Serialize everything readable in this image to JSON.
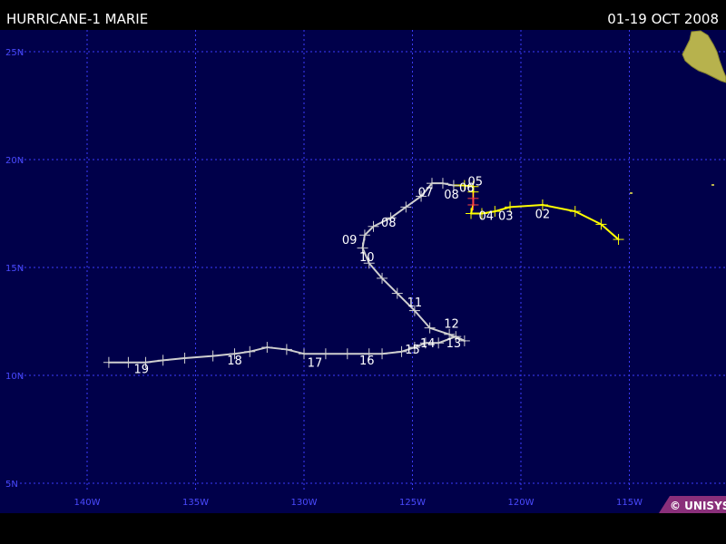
{
  "header": {
    "title": "HURRICANE-1 MARIE",
    "date_range": "01-19 OCT 2008"
  },
  "map": {
    "lat_labels": [
      {
        "lat": 25,
        "label": "25N"
      },
      {
        "lat": 20,
        "label": "20N"
      },
      {
        "lat": 15,
        "label": "15N"
      },
      {
        "lat": 10,
        "label": "10N"
      },
      {
        "lat": 5,
        "label": "5N"
      }
    ],
    "lon_labels": [
      {
        "lon": -140,
        "label": "140W"
      },
      {
        "lon": -135,
        "label": "135W"
      },
      {
        "lon": -130,
        "label": "130W"
      },
      {
        "lon": -125,
        "label": "125W"
      },
      {
        "lon": -120,
        "label": "120W"
      },
      {
        "lon": -115,
        "label": "115W"
      }
    ],
    "colors": {
      "ocean": "#00004a",
      "grid": "#3b3bff",
      "axis_label": "#4a4aff",
      "land": "#b7b24d",
      "track_storm": "#ffff00",
      "track_depression": "#cfcfcf",
      "track_hurricane": "#ff4444",
      "day_label": "#ffffff"
    },
    "land_icon": "land-mass-baja-california",
    "credit": "© UNISYS"
  },
  "chart_data": {
    "type": "map-track",
    "track": [
      {
        "lon": -115.5,
        "lat": 16.3,
        "stage": "storm"
      },
      {
        "lon": -116.3,
        "lat": 17.0,
        "stage": "storm"
      },
      {
        "lon": -117.5,
        "lat": 17.6,
        "stage": "storm"
      },
      {
        "lon": -119.0,
        "lat": 17.9,
        "stage": "storm"
      },
      {
        "lon": -120.5,
        "lat": 17.8,
        "stage": "storm"
      },
      {
        "lon": -121.2,
        "lat": 17.6,
        "stage": "storm"
      },
      {
        "lon": -121.8,
        "lat": 17.5,
        "stage": "storm"
      },
      {
        "lon": -122.3,
        "lat": 17.5,
        "stage": "storm"
      },
      {
        "lon": -122.2,
        "lat": 17.9,
        "stage": "hurricane"
      },
      {
        "lon": -122.2,
        "lat": 18.2,
        "stage": "hurricane"
      },
      {
        "lon": -122.2,
        "lat": 18.5,
        "stage": "storm"
      },
      {
        "lon": -122.2,
        "lat": 18.75,
        "stage": "storm"
      },
      {
        "lon": -122.6,
        "lat": 18.8,
        "stage": "storm"
      },
      {
        "lon": -123.1,
        "lat": 18.8,
        "stage": "depression"
      },
      {
        "lon": -123.6,
        "lat": 18.9,
        "stage": "depression"
      },
      {
        "lon": -124.1,
        "lat": 18.9,
        "stage": "depression"
      },
      {
        "lon": -124.6,
        "lat": 18.3,
        "stage": "depression"
      },
      {
        "lon": -125.3,
        "lat": 17.8,
        "stage": "depression"
      },
      {
        "lon": -126.0,
        "lat": 17.3,
        "stage": "depression"
      },
      {
        "lon": -126.8,
        "lat": 16.9,
        "stage": "depression"
      },
      {
        "lon": -127.2,
        "lat": 16.5,
        "stage": "depression"
      },
      {
        "lon": -127.3,
        "lat": 15.9,
        "stage": "depression"
      },
      {
        "lon": -127.0,
        "lat": 15.2,
        "stage": "depression"
      },
      {
        "lon": -126.4,
        "lat": 14.5,
        "stage": "depression"
      },
      {
        "lon": -125.7,
        "lat": 13.8,
        "stage": "depression"
      },
      {
        "lon": -124.9,
        "lat": 13.0,
        "stage": "depression"
      },
      {
        "lon": -124.2,
        "lat": 12.2,
        "stage": "depression"
      },
      {
        "lon": -123.3,
        "lat": 11.9,
        "stage": "depression"
      },
      {
        "lon": -122.6,
        "lat": 11.6,
        "stage": "depression"
      },
      {
        "lon": -123.0,
        "lat": 11.8,
        "stage": "depression"
      },
      {
        "lon": -123.8,
        "lat": 11.5,
        "stage": "depression"
      },
      {
        "lon": -124.4,
        "lat": 11.5,
        "stage": "depression"
      },
      {
        "lon": -124.9,
        "lat": 11.3,
        "stage": "depression"
      },
      {
        "lon": -125.5,
        "lat": 11.1,
        "stage": "depression"
      },
      {
        "lon": -126.4,
        "lat": 11.0,
        "stage": "depression"
      },
      {
        "lon": -127.0,
        "lat": 11.0,
        "stage": "depression"
      },
      {
        "lon": -128.0,
        "lat": 11.0,
        "stage": "depression"
      },
      {
        "lon": -129.0,
        "lat": 11.0,
        "stage": "depression"
      },
      {
        "lon": -130.0,
        "lat": 11.0,
        "stage": "depression"
      },
      {
        "lon": -130.8,
        "lat": 11.2,
        "stage": "depression"
      },
      {
        "lon": -131.7,
        "lat": 11.3,
        "stage": "depression"
      },
      {
        "lon": -132.5,
        "lat": 11.1,
        "stage": "depression"
      },
      {
        "lon": -133.2,
        "lat": 11.0,
        "stage": "depression"
      },
      {
        "lon": -134.2,
        "lat": 10.9,
        "stage": "depression"
      },
      {
        "lon": -135.5,
        "lat": 10.8,
        "stage": "depression"
      },
      {
        "lon": -136.5,
        "lat": 10.7,
        "stage": "depression"
      },
      {
        "lon": -137.3,
        "lat": 10.6,
        "stage": "depression"
      },
      {
        "lon": -138.1,
        "lat": 10.6,
        "stage": "depression"
      },
      {
        "lon": -139.0,
        "lat": 10.6,
        "stage": "depression"
      }
    ],
    "day_labels": [
      {
        "text": "02",
        "lon": -119.0,
        "lat": 17.3
      },
      {
        "text": "03",
        "lon": -120.7,
        "lat": 17.2
      },
      {
        "text": "04",
        "lon": -121.6,
        "lat": 17.2
      },
      {
        "text": "05",
        "lon": -122.1,
        "lat": 18.8
      },
      {
        "text": "06",
        "lon": -122.5,
        "lat": 18.5
      },
      {
        "text": "08",
        "lon": -123.2,
        "lat": 18.2
      },
      {
        "text": "07",
        "lon": -124.4,
        "lat": 18.3
      },
      {
        "text": "08",
        "lon": -126.1,
        "lat": 16.9
      },
      {
        "text": "09",
        "lon": -127.9,
        "lat": 16.1
      },
      {
        "text": "10",
        "lon": -127.1,
        "lat": 15.3
      },
      {
        "text": "11",
        "lon": -124.9,
        "lat": 13.2
      },
      {
        "text": "12",
        "lon": -123.2,
        "lat": 12.2
      },
      {
        "text": "13",
        "lon": -123.1,
        "lat": 11.3
      },
      {
        "text": "14",
        "lon": -124.3,
        "lat": 11.3
      },
      {
        "text": "15",
        "lon": -125.0,
        "lat": 11.0
      },
      {
        "text": "16",
        "lon": -127.1,
        "lat": 10.5
      },
      {
        "text": "17",
        "lon": -129.5,
        "lat": 10.4
      },
      {
        "text": "18",
        "lon": -133.2,
        "lat": 10.5
      },
      {
        "text": "19",
        "lon": -137.5,
        "lat": 10.1
      }
    ]
  }
}
